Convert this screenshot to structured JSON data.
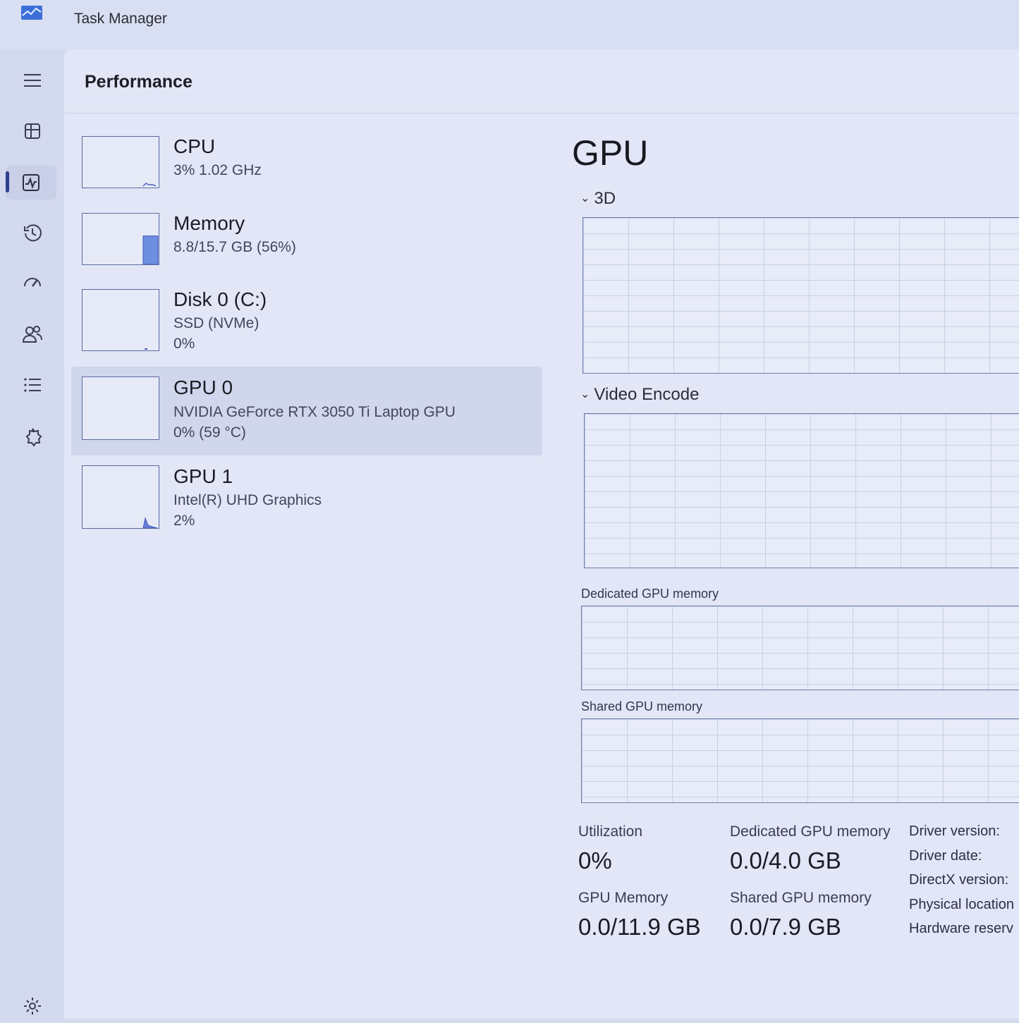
{
  "window": {
    "title": "Task Manager"
  },
  "nav": {
    "items": [
      {
        "name": "hamburger-menu-icon"
      },
      {
        "name": "processes-icon"
      },
      {
        "name": "performance-icon",
        "active": true
      },
      {
        "name": "app-history-icon"
      },
      {
        "name": "startup-apps-icon"
      },
      {
        "name": "users-icon"
      },
      {
        "name": "details-icon"
      },
      {
        "name": "services-icon"
      }
    ],
    "settings": {
      "name": "settings-icon"
    }
  },
  "page": {
    "title": "Performance"
  },
  "devices": [
    {
      "name": "CPU",
      "line1": "3%  1.02 GHz",
      "line2": ""
    },
    {
      "name": "Memory",
      "line1": "8.8/15.7 GB (56%)",
      "line2": ""
    },
    {
      "name": "Disk 0 (C:)",
      "line1": "SSD (NVMe)",
      "line2": "0%"
    },
    {
      "name": "GPU 0",
      "line1": "NVIDIA GeForce RTX 3050 Ti Laptop GPU",
      "line2": "0%  (59 °C)",
      "selected": true
    },
    {
      "name": "GPU 1",
      "line1": "Intel(R) UHD Graphics",
      "line2": "2%"
    }
  ],
  "detail": {
    "title": "GPU",
    "engines": [
      {
        "label": "3D"
      },
      {
        "label": "Video Encode"
      }
    ],
    "memory_graphs": [
      {
        "label": "Dedicated GPU memory"
      },
      {
        "label": "Shared GPU memory"
      }
    ],
    "stats": {
      "utilization": {
        "label": "Utilization",
        "value": "0%"
      },
      "dedicated": {
        "label": "Dedicated GPU memory",
        "value": "0.0/4.0 GB"
      },
      "gpu_memory": {
        "label": "GPU Memory",
        "value": "0.0/11.9 GB"
      },
      "shared": {
        "label": "Shared GPU memory",
        "value": "0.0/7.9 GB"
      }
    },
    "info": [
      "Driver version:",
      "Driver date:",
      "DirectX version:",
      "Physical location",
      "Hardware reserv"
    ]
  },
  "levels": {
    "memory_fill_fraction": 0.56
  },
  "colors": {
    "accent": "#2f3f8c",
    "graph_line": "#4a5fc0",
    "memory_fill": "#6e8ee0"
  }
}
